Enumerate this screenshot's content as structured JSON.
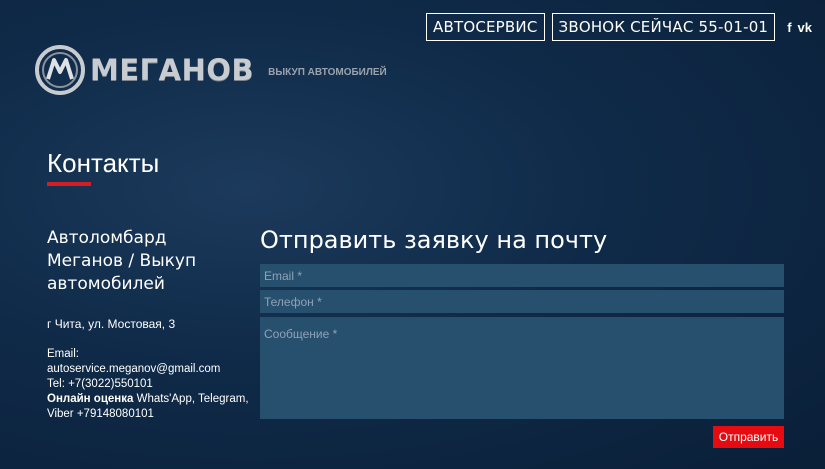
{
  "header": {
    "autoservice_label": "АВТОСЕРВИС",
    "call_label": "ЗВОНОК СЕЙЧАС 55-01-01",
    "facebook_label": "f",
    "vk_label": "vk"
  },
  "logo": {
    "word": "МЕГАНОВ",
    "subtitle": "ВЫКУП АВТОМОБИЛЕЙ"
  },
  "page": {
    "title": "Контакты"
  },
  "company": {
    "name": "Автоломбард Меганов / Выкуп автомобилей",
    "address": "г Чита, ул. Мостовая, 3",
    "email_label": "Email:",
    "email": "autoservice.meganov@gmail.com",
    "tel": "Tel:  +7(3022)550101",
    "online_label": "Онлайн оценка",
    "online_rest": " Whats'App, Telegram,",
    "viber": "Viber +79148080101"
  },
  "form": {
    "title": "Отправить заявку на почту",
    "email_placeholder": "Email *",
    "phone_placeholder": "Телефон *",
    "message_placeholder": "Сообщение *",
    "submit_label": "Отправить"
  }
}
